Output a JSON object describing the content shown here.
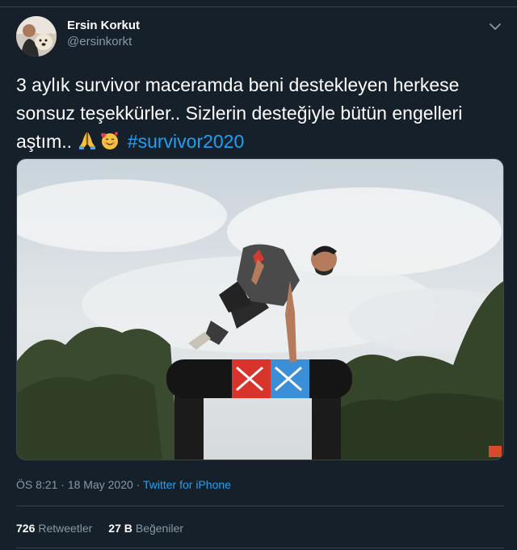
{
  "user": {
    "display_name": "Ersin Korkut",
    "handle": "@ersinkorkt"
  },
  "tweet": {
    "text_line": "3 aylık survivor maceramda beni destekleyen herkese sonsuz teşekkürler.. Sizlerin desteğiyle bütün engelleri aştım.. ",
    "hashtag": "#survivor2020",
    "emojis": [
      "folded-hands-icon",
      "smiling-face-with-hearts-icon"
    ]
  },
  "meta": {
    "time": "ÖS 8:21",
    "separator1": " · ",
    "date": "18 May 2020",
    "separator2": " · ",
    "source": "Twitter for iPhone"
  },
  "stats": {
    "retweets_count": "726",
    "retweets_label": "Retweetler",
    "likes_count": "27 B",
    "likes_label": "Beğeniler"
  },
  "colors": {
    "background": "#15202b",
    "accent": "#1da1f2",
    "secondary_text": "#8899a6",
    "divider": "#38444d"
  }
}
